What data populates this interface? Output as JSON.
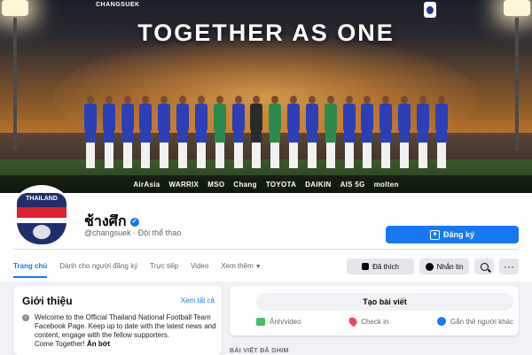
{
  "cover": {
    "slogan": "TOGETHER AS ONE",
    "brand": "CHANGSUEK",
    "sponsors": [
      "AirAsia",
      "WARRIX",
      "MSO",
      "Chang",
      "TOYOTA",
      "DAIKIN",
      "AIS 5G",
      "molten"
    ]
  },
  "profile": {
    "name": "ช้างศึก",
    "handle": "@changsuek · Đội thể thao",
    "subscribe_label": "Đăng ký"
  },
  "tabs": [
    {
      "label": "Trang chủ",
      "active": true
    },
    {
      "label": "Dành cho người đăng ký"
    },
    {
      "label": "Trực tiếp"
    },
    {
      "label": "Video"
    },
    {
      "label": "Xem thêm"
    }
  ],
  "actions": {
    "liked_label": "Đã thích",
    "message_label": "Nhắn tin"
  },
  "intro": {
    "title": "Giới thiệu",
    "see_all": "Xem tất cả",
    "text": "Welcome to the Official Thailand National Football Team Facebook Page. Keep up to date with the latest news and content, engage with the fellow supporters.",
    "more_prefix": "Come Together!",
    "more_link": "Ẩn bớt"
  },
  "composer": {
    "create_post": "Tạo bài viết",
    "photo_video": "Ảnh/video",
    "check_in": "Check in",
    "tag_people": "Gắn thẻ người khác"
  },
  "pinned_label": "BÀI VIẾT ĐÃ GHIM",
  "colors": {
    "accent": "#1877f2",
    "background": "#f0f2f5"
  }
}
